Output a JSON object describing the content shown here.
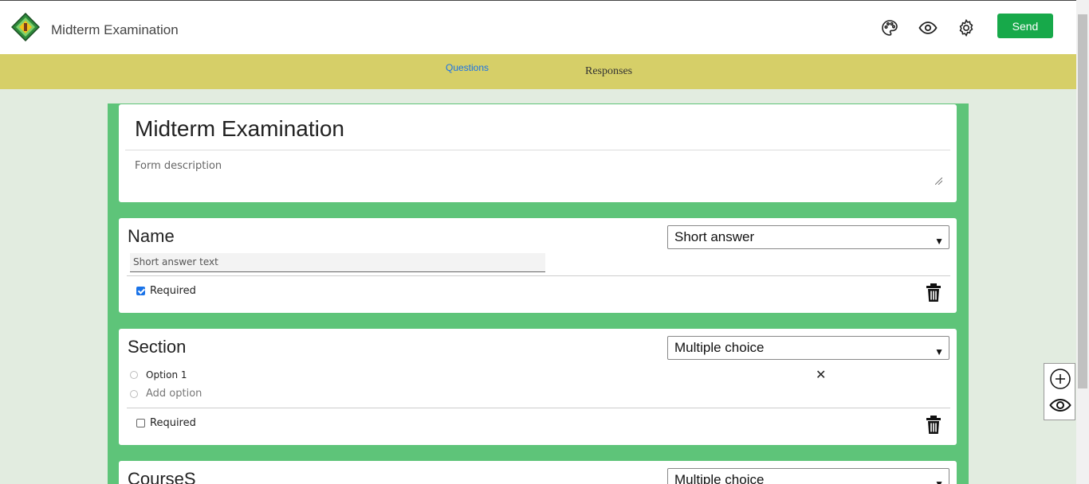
{
  "header": {
    "title": "Midterm Examination",
    "send_label": "Send",
    "icons": [
      "palette-icon",
      "eye-icon",
      "gear-icon"
    ]
  },
  "tabs": {
    "questions": "Questions",
    "responses": "Responses"
  },
  "form": {
    "title": "Midterm Examination",
    "description_placeholder": "Form description"
  },
  "questions": [
    {
      "title": "Name",
      "type": "Short answer",
      "placeholder": "Short answer text",
      "required_label": "Required",
      "required": true
    },
    {
      "title": "Section",
      "type": "Multiple choice",
      "options": [
        "Option 1"
      ],
      "add_option": "Add option",
      "required_label": "Required",
      "required": false
    },
    {
      "title": "CourseS",
      "type": "Multiple choice"
    }
  ],
  "colors": {
    "accent": "#17a94a",
    "tab_bar": "#d6cf68",
    "form_border": "#5ec479",
    "page_bg": "#e2ece0",
    "link": "#1a73e8"
  }
}
